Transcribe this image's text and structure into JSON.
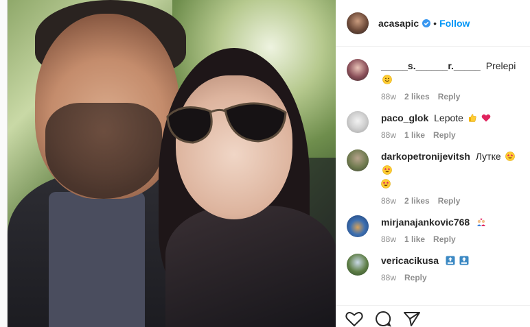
{
  "header": {
    "username": "acasapic",
    "separator": "•",
    "follow_label": "Follow"
  },
  "comments": [
    {
      "user": "_____s.______r._____",
      "text": "Prelepi",
      "emojis": [
        "slightly-smiling-face"
      ],
      "age": "88w",
      "likes": "2 likes",
      "reply": "Reply"
    },
    {
      "user": "paco_glok",
      "text": "Lepote",
      "emojis": [
        "thumbs-up",
        "heart"
      ],
      "age": "88w",
      "likes": "1 like",
      "reply": "Reply"
    },
    {
      "user": "darkopetronijevitsh",
      "text": "Лутке",
      "emojis": [
        "star-struck",
        "star-struck",
        "star-struck"
      ],
      "age": "88w",
      "likes": "2 likes",
      "reply": "Reply"
    },
    {
      "user": "mirjanajankovic768",
      "text": "",
      "emojis": [
        "couple-with-heart"
      ],
      "age": "88w",
      "likes": "1 like",
      "reply": "Reply"
    },
    {
      "user": "vericacikusa",
      "text": "",
      "emojis": [
        "top-arrow",
        "top-arrow"
      ],
      "age": "88w",
      "likes": "",
      "reply": "Reply"
    }
  ],
  "actions": {
    "icons": [
      "heart-icon",
      "comment-icon",
      "share-icon"
    ]
  },
  "colors": {
    "accent": "#0095f6",
    "meta": "#8e8e8e",
    "text": "#262626"
  }
}
